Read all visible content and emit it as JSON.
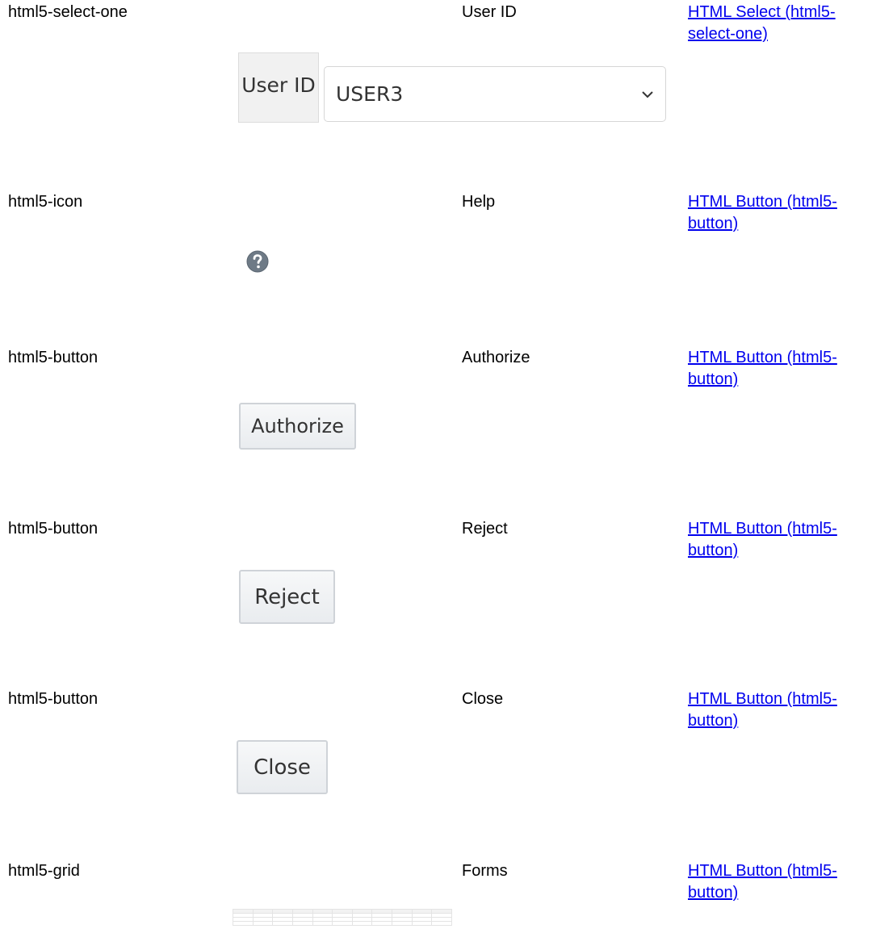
{
  "rows": [
    {
      "component_type": "html5-select-one",
      "label": "User ID",
      "link": "HTML Select (html5-select-one)",
      "widget": {
        "addon_text": "User ID",
        "selected_value": "USER3"
      }
    },
    {
      "component_type": "html5-icon",
      "label": "Help",
      "link": "HTML Button (html5-button)",
      "widget": {
        "icon": "help-icon",
        "icon_color": "#6e7a86"
      }
    },
    {
      "component_type": "html5-button",
      "label": "Authorize",
      "link": "HTML Button (html5-button)",
      "widget": {
        "button_text": "Authorize"
      }
    },
    {
      "component_type": "html5-button",
      "label": "Reject",
      "link": "HTML Button (html5-button)",
      "widget": {
        "button_text": "Reject"
      }
    },
    {
      "component_type": "html5-button",
      "label": "Close",
      "link": "HTML Button (html5-button)",
      "widget": {
        "button_text": "Close"
      }
    },
    {
      "component_type": "html5-grid",
      "label": "Forms",
      "link": "HTML Button (html5-button)",
      "widget": {
        "grid": "forms-grid-thumbnail"
      }
    }
  ]
}
